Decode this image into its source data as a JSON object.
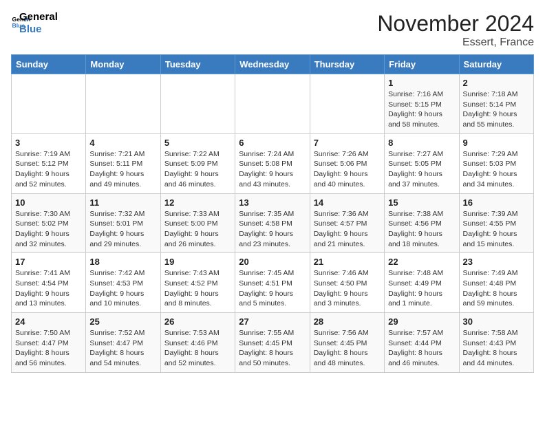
{
  "logo": {
    "text_general": "General",
    "text_blue": "Blue"
  },
  "header": {
    "month_year": "November 2024",
    "location": "Essert, France"
  },
  "columns": [
    "Sunday",
    "Monday",
    "Tuesday",
    "Wednesday",
    "Thursday",
    "Friday",
    "Saturday"
  ],
  "weeks": [
    [
      {
        "day": "",
        "info": ""
      },
      {
        "day": "",
        "info": ""
      },
      {
        "day": "",
        "info": ""
      },
      {
        "day": "",
        "info": ""
      },
      {
        "day": "",
        "info": ""
      },
      {
        "day": "1",
        "info": "Sunrise: 7:16 AM\nSunset: 5:15 PM\nDaylight: 9 hours\nand 58 minutes."
      },
      {
        "day": "2",
        "info": "Sunrise: 7:18 AM\nSunset: 5:14 PM\nDaylight: 9 hours\nand 55 minutes."
      }
    ],
    [
      {
        "day": "3",
        "info": "Sunrise: 7:19 AM\nSunset: 5:12 PM\nDaylight: 9 hours\nand 52 minutes."
      },
      {
        "day": "4",
        "info": "Sunrise: 7:21 AM\nSunset: 5:11 PM\nDaylight: 9 hours\nand 49 minutes."
      },
      {
        "day": "5",
        "info": "Sunrise: 7:22 AM\nSunset: 5:09 PM\nDaylight: 9 hours\nand 46 minutes."
      },
      {
        "day": "6",
        "info": "Sunrise: 7:24 AM\nSunset: 5:08 PM\nDaylight: 9 hours\nand 43 minutes."
      },
      {
        "day": "7",
        "info": "Sunrise: 7:26 AM\nSunset: 5:06 PM\nDaylight: 9 hours\nand 40 minutes."
      },
      {
        "day": "8",
        "info": "Sunrise: 7:27 AM\nSunset: 5:05 PM\nDaylight: 9 hours\nand 37 minutes."
      },
      {
        "day": "9",
        "info": "Sunrise: 7:29 AM\nSunset: 5:03 PM\nDaylight: 9 hours\nand 34 minutes."
      }
    ],
    [
      {
        "day": "10",
        "info": "Sunrise: 7:30 AM\nSunset: 5:02 PM\nDaylight: 9 hours\nand 32 minutes."
      },
      {
        "day": "11",
        "info": "Sunrise: 7:32 AM\nSunset: 5:01 PM\nDaylight: 9 hours\nand 29 minutes."
      },
      {
        "day": "12",
        "info": "Sunrise: 7:33 AM\nSunset: 5:00 PM\nDaylight: 9 hours\nand 26 minutes."
      },
      {
        "day": "13",
        "info": "Sunrise: 7:35 AM\nSunset: 4:58 PM\nDaylight: 9 hours\nand 23 minutes."
      },
      {
        "day": "14",
        "info": "Sunrise: 7:36 AM\nSunset: 4:57 PM\nDaylight: 9 hours\nand 21 minutes."
      },
      {
        "day": "15",
        "info": "Sunrise: 7:38 AM\nSunset: 4:56 PM\nDaylight: 9 hours\nand 18 minutes."
      },
      {
        "day": "16",
        "info": "Sunrise: 7:39 AM\nSunset: 4:55 PM\nDaylight: 9 hours\nand 15 minutes."
      }
    ],
    [
      {
        "day": "17",
        "info": "Sunrise: 7:41 AM\nSunset: 4:54 PM\nDaylight: 9 hours\nand 13 minutes."
      },
      {
        "day": "18",
        "info": "Sunrise: 7:42 AM\nSunset: 4:53 PM\nDaylight: 9 hours\nand 10 minutes."
      },
      {
        "day": "19",
        "info": "Sunrise: 7:43 AM\nSunset: 4:52 PM\nDaylight: 9 hours\nand 8 minutes."
      },
      {
        "day": "20",
        "info": "Sunrise: 7:45 AM\nSunset: 4:51 PM\nDaylight: 9 hours\nand 5 minutes."
      },
      {
        "day": "21",
        "info": "Sunrise: 7:46 AM\nSunset: 4:50 PM\nDaylight: 9 hours\nand 3 minutes."
      },
      {
        "day": "22",
        "info": "Sunrise: 7:48 AM\nSunset: 4:49 PM\nDaylight: 9 hours\nand 1 minute."
      },
      {
        "day": "23",
        "info": "Sunrise: 7:49 AM\nSunset: 4:48 PM\nDaylight: 8 hours\nand 59 minutes."
      }
    ],
    [
      {
        "day": "24",
        "info": "Sunrise: 7:50 AM\nSunset: 4:47 PM\nDaylight: 8 hours\nand 56 minutes."
      },
      {
        "day": "25",
        "info": "Sunrise: 7:52 AM\nSunset: 4:47 PM\nDaylight: 8 hours\nand 54 minutes."
      },
      {
        "day": "26",
        "info": "Sunrise: 7:53 AM\nSunset: 4:46 PM\nDaylight: 8 hours\nand 52 minutes."
      },
      {
        "day": "27",
        "info": "Sunrise: 7:55 AM\nSunset: 4:45 PM\nDaylight: 8 hours\nand 50 minutes."
      },
      {
        "day": "28",
        "info": "Sunrise: 7:56 AM\nSunset: 4:45 PM\nDaylight: 8 hours\nand 48 minutes."
      },
      {
        "day": "29",
        "info": "Sunrise: 7:57 AM\nSunset: 4:44 PM\nDaylight: 8 hours\nand 46 minutes."
      },
      {
        "day": "30",
        "info": "Sunrise: 7:58 AM\nSunset: 4:43 PM\nDaylight: 8 hours\nand 44 minutes."
      }
    ]
  ]
}
